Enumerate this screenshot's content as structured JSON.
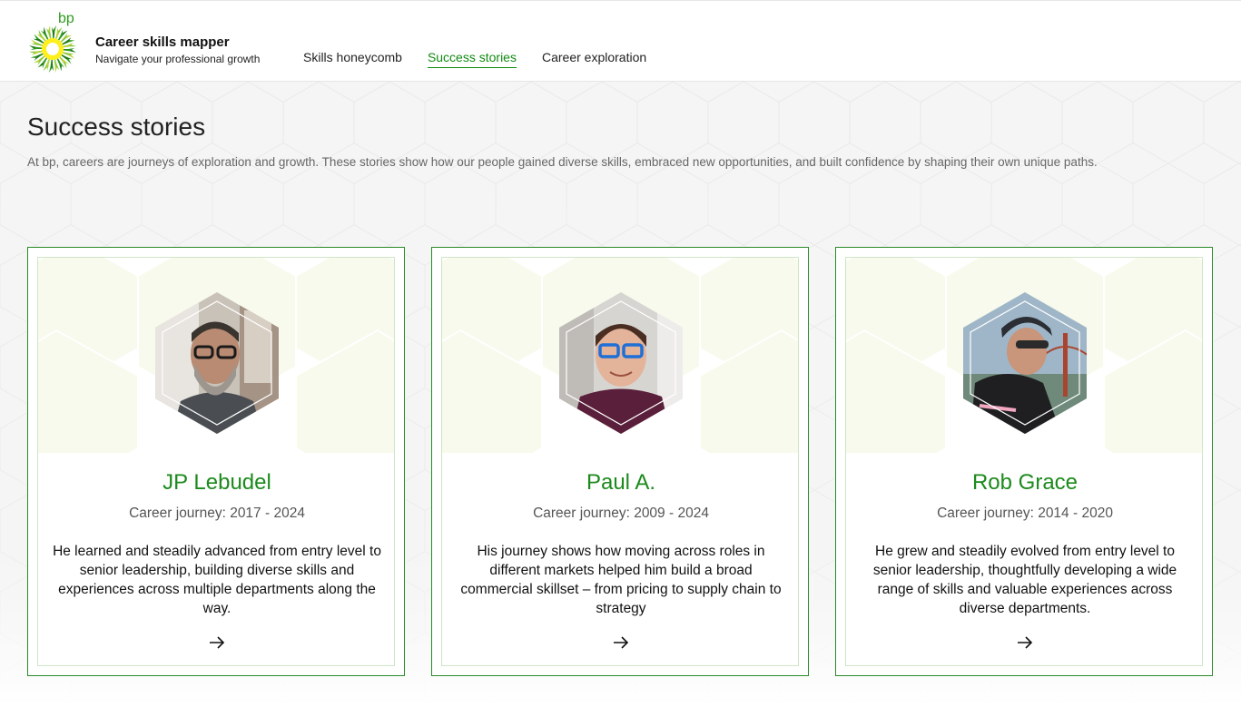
{
  "header": {
    "logo_text": "bp",
    "title": "Career skills mapper",
    "subtitle": "Navigate your professional growth",
    "nav": [
      {
        "label": "Skills honeycomb",
        "active": false
      },
      {
        "label": "Success stories",
        "active": true
      },
      {
        "label": "Career exploration",
        "active": false
      }
    ]
  },
  "page": {
    "title": "Success stories",
    "description": "At bp, careers are journeys of exploration and growth. These stories show how our people gained diverse skills, embraced new opportunities, and built confidence by shaping their own unique paths."
  },
  "cards": [
    {
      "name": "JP Lebudel",
      "journey": "Career journey: 2017 - 2024",
      "description": "He learned and steadily advanced from entry level to senior leadership, building diverse skills and experiences across multiple departments along the way.",
      "arrow_icon": "arrow-right-icon"
    },
    {
      "name": "Paul A.",
      "journey": "Career journey: 2009 - 2024",
      "description": "His journey shows how moving across roles in different markets helped him build a broad commercial skillset – from pricing to supply chain to strategy",
      "arrow_icon": "arrow-right-icon"
    },
    {
      "name": "Rob Grace",
      "journey": "Career journey: 2014 - 2020",
      "description": "He grew and steadily evolved from entry level to senior leadership, thoughtfully developing a wide range of skills and valuable experiences across diverse departments.",
      "arrow_icon": "arrow-right-icon"
    }
  ],
  "colors": {
    "accent": "#1c8a1c",
    "card_border": "#2a8b2a",
    "page_bg": "#f5f5f5"
  }
}
